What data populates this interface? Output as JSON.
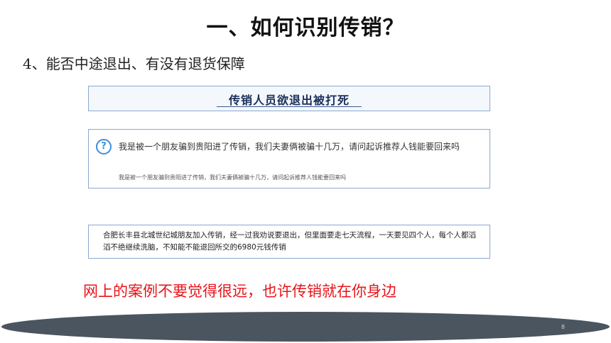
{
  "slide": {
    "title": "一、如何识别传销？",
    "subtitle": "4、能否中途退出、有没有退货保障",
    "news_heading": "传销人员欲退出被打死",
    "question": {
      "icon": "question-icon",
      "main": "我是被一个朋友骗到贵阳进了传销，我们夫妻俩被骗十几万，请问起诉推荐人钱能要回来吗",
      "sub": "我是被一个朋友骗到贵阳进了传销，我们夫妻俩被骗十几万，请问起诉推荐人钱能要回来吗"
    },
    "case_text": "合肥长丰县北城世纪城朋友加入传销，经一过我劝说要退出，但里面要走七天流程，一天要见四个人，每个人都滔滔不绝继续洗脑，不知能不能退回所交的6980元钱传销",
    "note": "网上的案例不要觉得很远，也许传销就在你身边",
    "page_number": "8"
  },
  "colors": {
    "note": "#e8141b",
    "icon": "#3b8ede",
    "footer": "#4a5560"
  }
}
